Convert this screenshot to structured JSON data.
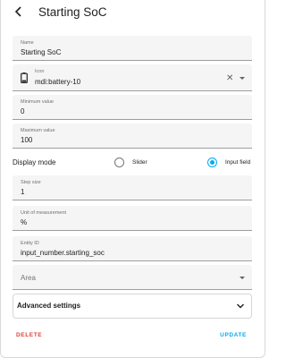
{
  "header": {
    "title": "Starting SoC"
  },
  "form": {
    "name": {
      "label": "Name",
      "value": "Starting SoC"
    },
    "icon": {
      "label": "Icon",
      "value": "mdi:battery-10",
      "icon_name": "battery-10-icon"
    },
    "minimum": {
      "label": "Minimum value",
      "value": "0"
    },
    "maximum": {
      "label": "Maximum value",
      "value": "100"
    },
    "display_mode": {
      "label": "Display mode",
      "options": [
        {
          "label": "Slider",
          "checked": false
        },
        {
          "label": "Input field",
          "checked": true
        }
      ]
    },
    "step": {
      "label": "Step size",
      "value": "1"
    },
    "unit": {
      "label": "Unit of measurement",
      "value": "%"
    },
    "entity_id": {
      "label": "Entity ID",
      "value": "input_number.starting_soc"
    },
    "area": {
      "label": "Area",
      "value": ""
    }
  },
  "advanced": {
    "title": "Advanced settings"
  },
  "actions": {
    "delete": "DELETE",
    "update": "UPDATE"
  },
  "colors": {
    "accent": "#03a9f4",
    "danger": "#db4437",
    "field_bg": "#f5f5f5"
  }
}
